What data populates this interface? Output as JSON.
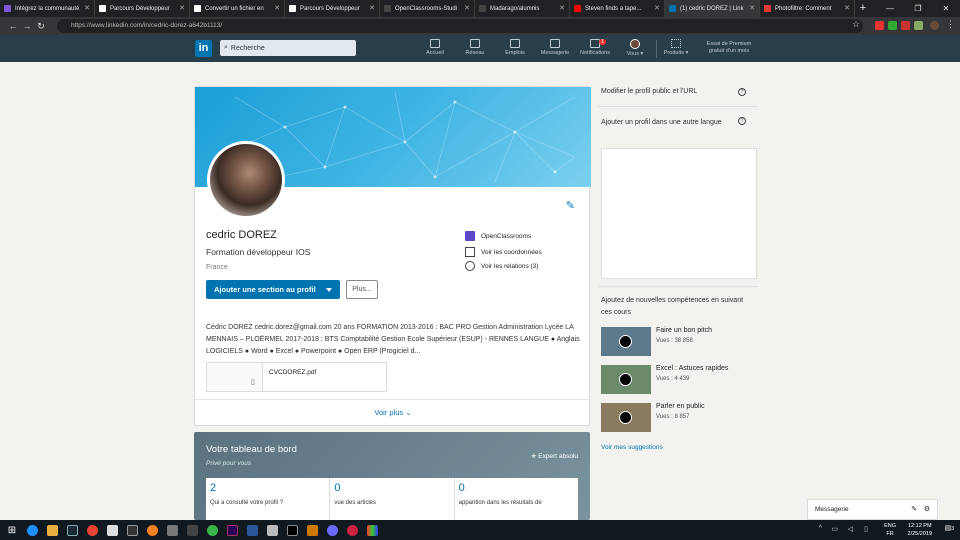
{
  "browser": {
    "tabs": [
      {
        "label": "Intégrez la communauté",
        "color": "#7b5cd6"
      },
      {
        "label": "Parcours Développeur",
        "color": "#ffffff"
      },
      {
        "label": "Convertir un fichier en",
        "color": "#ffffff"
      },
      {
        "label": "Parcours Développeur",
        "color": "#ffffff"
      },
      {
        "label": "OpenClassrooms-Studi",
        "color": "#222222"
      },
      {
        "label": "Madarago/alumnis",
        "color": "#222222"
      },
      {
        "label": "Steven finds a tape...",
        "color": "#ff0000"
      },
      {
        "label": "(1) cedric DOREZ | Link",
        "color": "#0073b1"
      },
      {
        "label": "Photofiltre: Comment",
        "color": "#e53935"
      }
    ],
    "url": "https://www.linkedin.com/in/cedric-dorez-a642b1113/"
  },
  "linkedin_nav": {
    "logo": "in",
    "search_placeholder": "Recherche",
    "items": [
      {
        "label": "Accueil",
        "icon": "home-icon"
      },
      {
        "label": "Réseau",
        "icon": "network-icon"
      },
      {
        "label": "Emplois",
        "icon": "briefcase-icon"
      },
      {
        "label": "Messagerie",
        "icon": "messaging-icon"
      },
      {
        "label": "Notifications",
        "icon": "bell-icon",
        "badge": "1"
      },
      {
        "label": "Vous ▾",
        "icon": "avatar"
      },
      {
        "label": "Produits ▾",
        "icon": "grid-icon"
      }
    ],
    "premium_line1": "Essai de Premium",
    "premium_line2": "gratuit d'un mois"
  },
  "profile": {
    "name": "cedric DOREZ",
    "headline": "Formation développeur IOS",
    "location": "France",
    "add_section_button": "Ajouter une section au profil",
    "more_button": "Plus...",
    "school": "OpenClassrooms",
    "contact_link": "Voir les coordonnées",
    "relations_link": "Voir les relations (3)",
    "summary": "Cédric DOREZ cedric.dorez@gmail.com 20 ans FORMATION 2013-2016 : BAC PRO Gestion Administration Lycée LA MENNAIS – PLOËRMEL 2017-2018 : BTS Comptabilité Gestion Ecole Supérieur (ESUP) - RENNES LANGUE ● Anglais LOGICIELS ● Word ● Excel ● Powerpoint ● Open ERP (Progiciel d...",
    "document_name": "CVCDOREZ.pdf",
    "see_more": "Voir plus"
  },
  "dashboard": {
    "title": "Votre tableau de bord",
    "subtitle": "Privé pour vous",
    "expert": "Expert absolu",
    "stats": [
      {
        "value": "2",
        "label": "Qui a consulté votre profil ?"
      },
      {
        "value": "0",
        "label": "vue des articles"
      },
      {
        "value": "0",
        "label": "apparition dans les résultats de"
      }
    ]
  },
  "right_rail": {
    "edit_public_profile": "Modifier le profil public et l'URL",
    "add_profile_lang": "Ajouter un profil dans une autre langue",
    "courses_heading": "Ajoutez de nouvelles compétences en suivant ces cours",
    "courses": [
      {
        "title": "Faire un bon pitch",
        "views": "Vues : 38 858"
      },
      {
        "title": "Excel : Astuces rapides",
        "views": "Vues : 4 439"
      },
      {
        "title": "Parler en public",
        "views": "Vues : 8 857"
      }
    ],
    "see_suggestions": "Voir mes suggestions"
  },
  "messaging": {
    "label": "Messagerie"
  },
  "taskbar": {
    "lang_top": "ENG",
    "lang_bottom": "FR",
    "time": "12:12 PM",
    "date": "2/25/2019",
    "notification_count": "3"
  }
}
